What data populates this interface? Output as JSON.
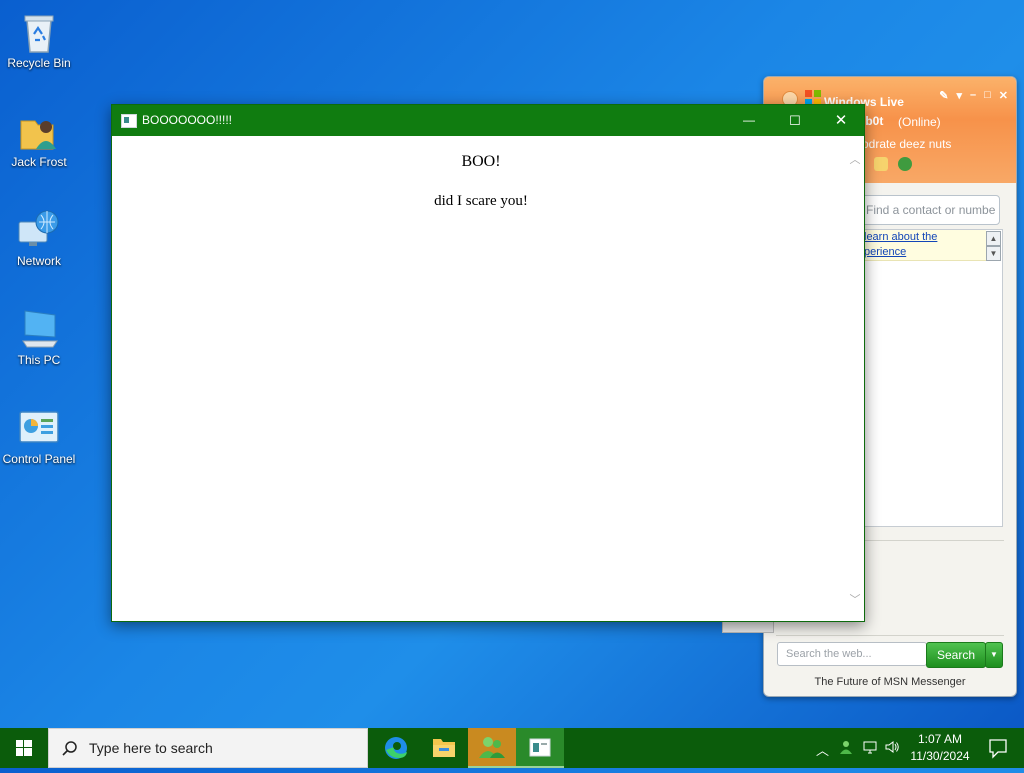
{
  "desktop": {
    "icons": [
      {
        "label": "Recycle Bin",
        "icon": "recycle-bin-icon"
      },
      {
        "label": "Jack Frost",
        "icon": "user-folder-icon"
      },
      {
        "label": "Network",
        "icon": "network-icon"
      },
      {
        "label": "This PC",
        "icon": "computer-icon"
      },
      {
        "label": "Control Panel",
        "icon": "control-panel-icon"
      }
    ]
  },
  "boo_window": {
    "title": "BOOOOOOO!!!!!",
    "heading": "BOO!",
    "message": "did I scare you!",
    "controls": {
      "minimize": "—",
      "maximize": "☐",
      "close": "✕"
    }
  },
  "messenger": {
    "title": "Windows Live",
    "user": "lb0t",
    "status": "(Online)",
    "personal_message": "odrate deez nuts",
    "find_placeholder": "Find a contact or numbe",
    "promo_line1": "learn about the",
    "promo_line2": "perience",
    "web_search_placeholder": "Search the web...",
    "search_button": "Search",
    "footer": "The Future of MSN Messenger",
    "colors": {
      "header": "#f7924a",
      "search_button": "#1e8f1e"
    }
  },
  "taskbar": {
    "search_placeholder": "Type here to search",
    "apps": [
      "edge-icon",
      "file-explorer-icon",
      "messenger-icon",
      "window-app-icon"
    ],
    "clock_time": "1:07 AM",
    "clock_date": "11/30/2024",
    "accent": "#0b5c0b"
  }
}
